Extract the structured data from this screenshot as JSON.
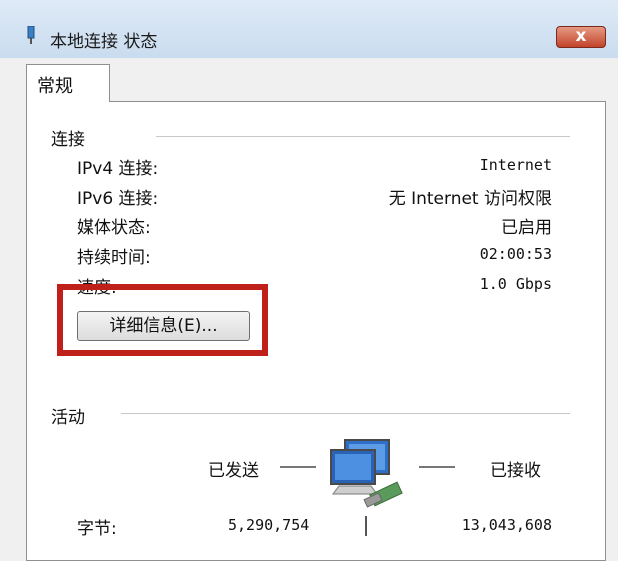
{
  "window": {
    "title": "本地连接 状态",
    "close_glyph": "x"
  },
  "tabs": [
    {
      "label": "常规"
    }
  ],
  "connection": {
    "section_label": "连接",
    "rows": [
      {
        "label": "IPv4 连接:",
        "value": "Internet"
      },
      {
        "label": "IPv6 连接:",
        "value": "无 Internet 访问权限"
      },
      {
        "label": "媒体状态:",
        "value": "已启用"
      },
      {
        "label": "持续时间:",
        "value": "02:00:53"
      },
      {
        "label": "速度:",
        "value": "1.0 Gbps"
      }
    ],
    "details_button": "详细信息(E)..."
  },
  "activity": {
    "section_label": "活动",
    "sent_label": "已发送",
    "received_label": "已接收",
    "bytes_label": "字节:",
    "bytes_sent": "5,290,754",
    "bytes_received": "13,043,608"
  },
  "icons": {
    "title": "network-connection-icon",
    "activity": "network-computers-icon"
  },
  "colors": {
    "highlight": "#c0201a",
    "close_button": "#c2432b"
  }
}
